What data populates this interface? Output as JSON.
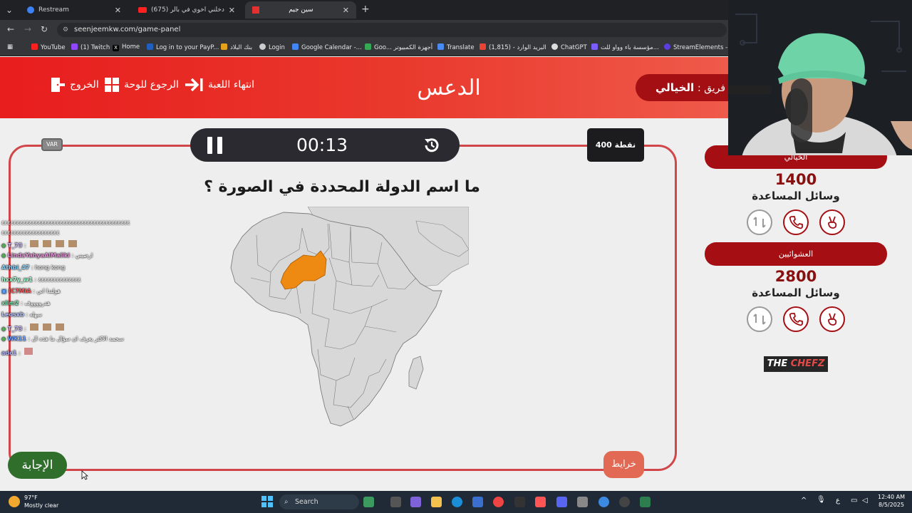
{
  "browser": {
    "tabs": [
      {
        "title": "Restream",
        "active": false
      },
      {
        "title": "(675) مقلب دخلني اخوي في بالر...",
        "active": false
      },
      {
        "title": "سين جيم",
        "active": true
      }
    ],
    "new_tab": "+",
    "url": "seenjeemkw.com/game-panel",
    "bookmarks": [
      "YouTube",
      "(1) Twitch",
      "Home",
      "Log in to your PayP...",
      "بنك البلاد",
      "Login",
      "Google Calendar -...",
      "Goo... أجهزة الكمبيوتر",
      "Translate",
      "البريد الوارد - (1,815)",
      "ChatGPT",
      "مؤسسة باء وواو للت...",
      "StreamElements - M..."
    ]
  },
  "header": {
    "exit_label": "الخروج",
    "back_label": "الرجوع للوحة",
    "end_game_label": "انتهاء اللعبة",
    "category": "الدعس",
    "current_team_prefix": "فريق :",
    "current_team_name": "الخيالي"
  },
  "board": {
    "timer": "00:13",
    "points_label": "400 نقطة",
    "var_label": "VAR",
    "question": "ما اسم الدولة المحددة في الصورة ؟",
    "answer_button": "الإجابة",
    "map_button": "خرايط"
  },
  "teams": [
    {
      "name": "الخيالي",
      "score": "1400",
      "aids_label": "وسائل المساعدة"
    },
    {
      "name": "العشوائيين",
      "score": "2800",
      "aids_label": "وسائل المساعدة"
    }
  ],
  "sponsor": {
    "part1": "THE ",
    "part2": "CHEFZ"
  },
  "chat": [
    {
      "user": "",
      "text": "٤٤٤٤٤٤٤٤٤٤٤٤٤٤٤٤٤٤٤٤٤٤٤٤٤٤٤٤٤٤٤٤٤٤٤٤٤٤٤٤٤٤",
      "color": "#ffffff"
    },
    {
      "user": "",
      "text": "٤٤٤٤٤٤٤٤٤٤٤٤٤٤٤٤٤٤٤",
      "color": "#ffffff"
    },
    {
      "user": "T_73",
      "text": "",
      "color": "#c9b2ff"
    },
    {
      "user": "LindaYahyaAlMaliki",
      "text": ": ارضيني",
      "color": "#e48fd6"
    },
    {
      "user": "Athbi_47",
      "text": ": hong kong",
      "color": "#7fd0ff"
    },
    {
      "user": "hxx7y_w1",
      "text": ": ٤٤٤٤٤٤٤٤٤٤٤٤٤٤",
      "color": "#9affc9"
    },
    {
      "user": "IC7MIA",
      "text": ": هولندا اني",
      "color": "#ff5b5b"
    },
    {
      "user": "xlim2",
      "text": ": هدرووووف",
      "color": "#7ce0a8"
    },
    {
      "user": "Leosxb",
      "text": ": سهله",
      "color": "#b8c2ff"
    },
    {
      "user": "T_73",
      "text": "",
      "color": "#c9b2ff"
    },
    {
      "user": "WK11",
      "text": ": سحمد الاكثر يعرف ان سؤال ما هذه ال",
      "color": "#6fa0ff"
    },
    {
      "user": "adc1",
      "text": "",
      "color": "#b0b0ff"
    }
  ],
  "taskbar": {
    "weather_temp": "97°F",
    "weather_desc": "Mostly clear",
    "search_placeholder": "Search",
    "lang": "ع",
    "time": "12:40 AM",
    "date": "8/5/2025"
  },
  "colors": {
    "header_red": "#e81d1d",
    "team_red": "#a50f14",
    "board_border": "#d1464a",
    "highlight_country": "#ee8a12",
    "land": "#d8d8d8"
  }
}
